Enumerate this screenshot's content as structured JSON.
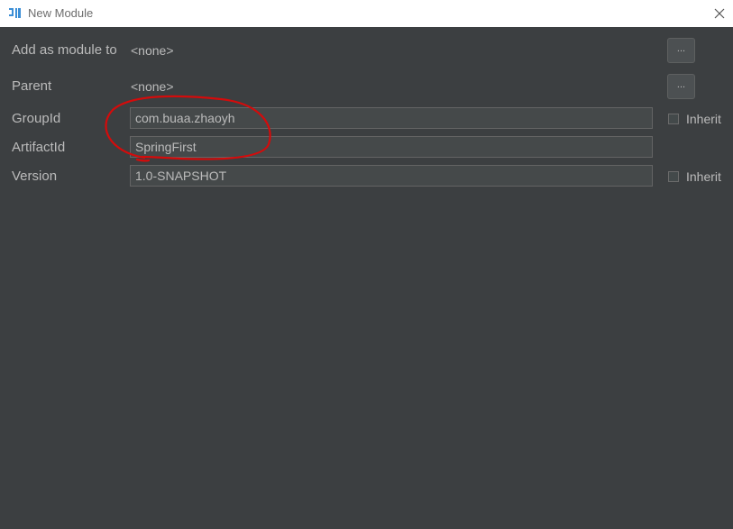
{
  "window": {
    "title": "New Module",
    "close_glyph": "✕"
  },
  "app_icon": {
    "letters": "IJ",
    "color": "#3b8ed6"
  },
  "form": {
    "add_as_module_to": {
      "label": "Add as module to",
      "value": "<none>",
      "button_label": "..."
    },
    "parent": {
      "label": "Parent",
      "value": "<none>",
      "button_label": "..."
    },
    "group_id": {
      "label": "GroupId",
      "value": "com.buaa.zhaoyh",
      "inherit_label": "Inherit",
      "inherit_checked": false
    },
    "artifact_id": {
      "label": "ArtifactId",
      "value": "SpringFirst"
    },
    "version": {
      "label": "Version",
      "value": "1.0-SNAPSHOT",
      "inherit_label": "Inherit",
      "inherit_checked": false
    }
  },
  "annotation": {
    "color": "#d40b0b",
    "shape": "hand-drawn circle around GroupId and ArtifactId fields"
  }
}
